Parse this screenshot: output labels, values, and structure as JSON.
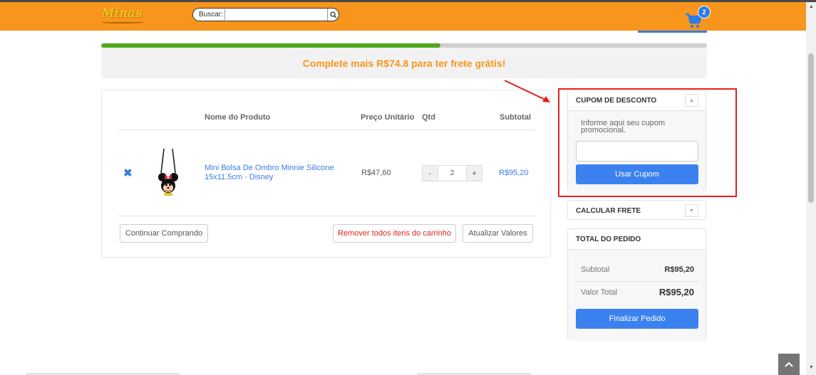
{
  "header": {
    "logo_text": "Minas",
    "search_label": "Buscar:",
    "search_value": "",
    "cart_count": "2",
    "colors": {
      "header_bg": "#f7951d",
      "accent_blue": "#3b7be0"
    }
  },
  "shipping_progress": {
    "message": "Complete mais R$74.8 para ter frete grátis!",
    "progress_fraction": 0.56
  },
  "cart": {
    "headers": {
      "product": "Nome do Produto",
      "unit_price": "Preço Unitário",
      "qty": "Qtd",
      "subtotal": "Subtotal"
    },
    "items": [
      {
        "name": "Mini Bolsa De Ombro Minnie Silicone 15x11.5cm - Disney",
        "unit_price": "R$47,60",
        "qty": "2",
        "subtotal": "R$95,20",
        "remove_icon": "close-x-icon",
        "image": "minnie-bag-product-image"
      }
    ],
    "qty_minus": "-",
    "qty_plus": "+",
    "continue_label": "Continuar Comprando",
    "remove_all_label": "Remover todos itens do carrinho",
    "update_label": "Atualizar Valores"
  },
  "coupon": {
    "title": "CUPOM DE DESCONTO",
    "hint": "Informe aqui seu cupom promocional.",
    "input_value": "",
    "button_label": "Usar Cupom"
  },
  "shipping_calc": {
    "title": "CALCULAR FRETE"
  },
  "totals": {
    "title": "TOTAL DO PEDIDO",
    "subtotal_label": "Subtotal",
    "subtotal_value": "R$95,20",
    "total_label": "Valor Total",
    "total_value": "R$95,20",
    "checkout_label": "Finalizar Pedido"
  }
}
